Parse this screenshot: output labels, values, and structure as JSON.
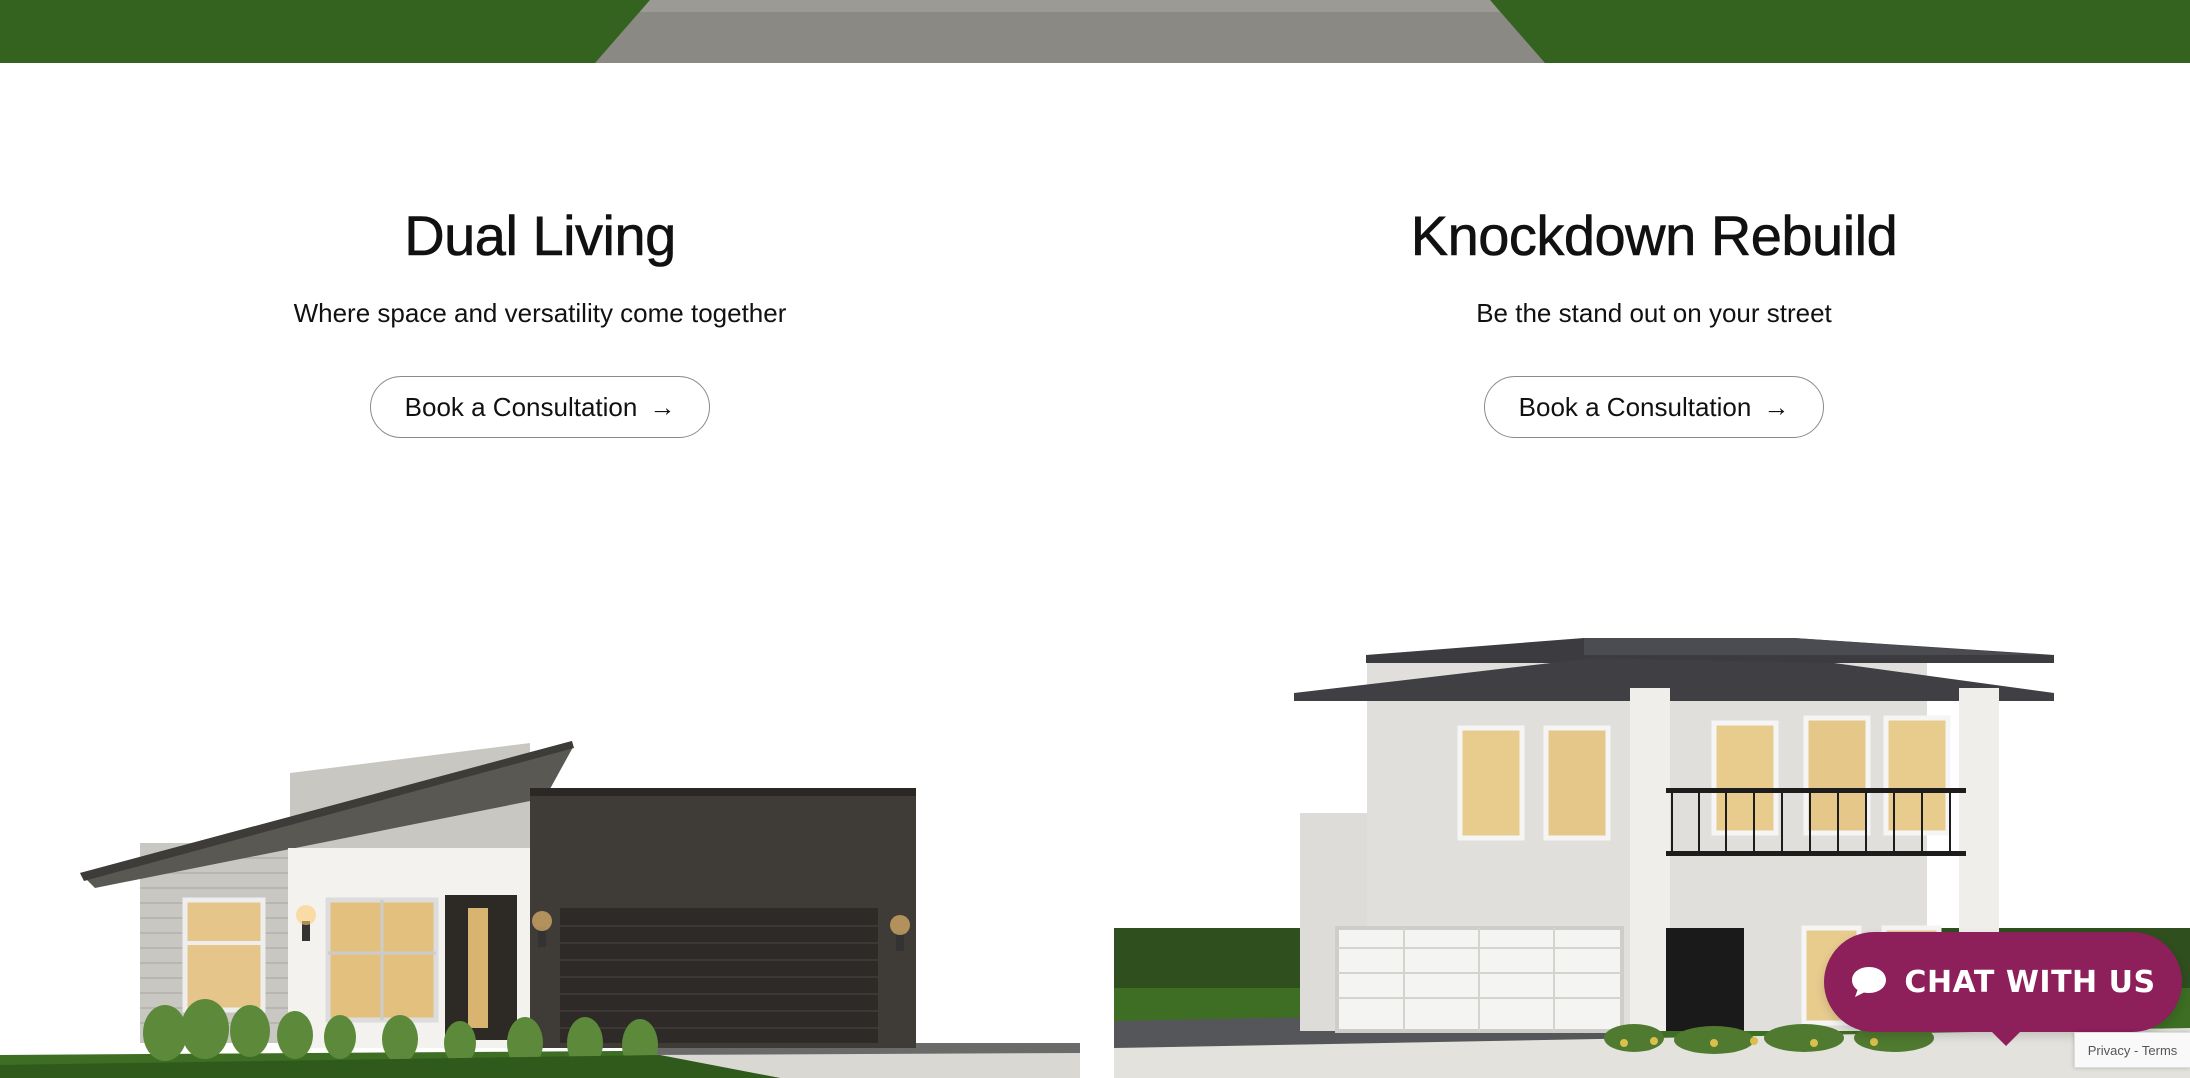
{
  "cards": [
    {
      "title": "Dual Living",
      "subtitle": "Where space and versatility come together",
      "button_label": "Book a Consultation",
      "button_arrow": "→"
    },
    {
      "title": "Knockdown Rebuild",
      "subtitle": "Be the stand out on your street",
      "button_label": "Book a Consultation",
      "button_arrow": "→"
    }
  ],
  "chat": {
    "label": "CHAT WITH US",
    "icon": "chat-bubble-icon"
  },
  "recaptcha": {
    "privacy": "Privacy",
    "separator": " - ",
    "terms": "Terms"
  },
  "colors": {
    "accent": "#8d1f5b",
    "lawn": "#2f5a1c",
    "driveway": "#8a8984"
  }
}
